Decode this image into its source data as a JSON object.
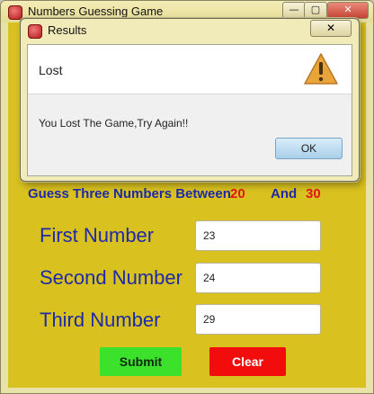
{
  "main_window": {
    "title": "Numbers Guessing Game",
    "controls": {
      "minimize": "—",
      "maximize": "▢",
      "close": "✕"
    }
  },
  "game": {
    "heading": "Guess Three Numbers Between",
    "range_low": "20",
    "and_label": "And",
    "range_high": "30",
    "fields": [
      {
        "label": "First Number",
        "value": "23"
      },
      {
        "label": "Second Number",
        "value": "24"
      },
      {
        "label": "Third Number",
        "value": "29"
      }
    ],
    "submit_label": "Submit",
    "clear_label": "Clear"
  },
  "dialog": {
    "title": "Results",
    "close": "✕",
    "heading": "Lost",
    "message": "You Lost The Game,Try Again!!",
    "ok_label": "OK",
    "icon": "warning-icon"
  },
  "colors": {
    "background": "#d9c11f",
    "label_text": "#1e2aa8",
    "range_numbers": "#e01515",
    "submit": "#3be12a",
    "clear": "#f20c0c"
  }
}
